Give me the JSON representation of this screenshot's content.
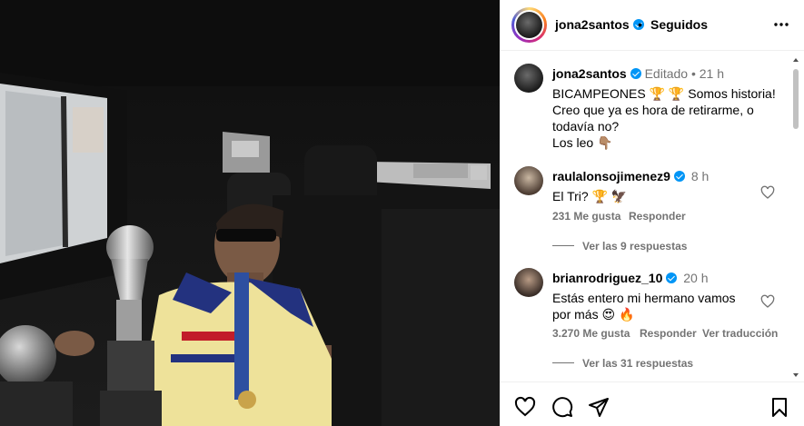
{
  "post": {
    "username": "jona2santos",
    "separator": "•",
    "follow_status": "Seguidos"
  },
  "caption": {
    "username": "jona2santos",
    "edited": "Editado",
    "dot": "•",
    "time": "21 h",
    "line1_text": "BICAMPEONES",
    "line1_emoji": "🏆 🏆",
    "line1_tail": "Somos historia!",
    "line2": "Creo que ya es hora de retirarme, o",
    "line3": "todavía no?",
    "line4_text": "Los leo",
    "line4_emoji": "👇🏽"
  },
  "comments": [
    {
      "username": "raulalonsojimenez9",
      "time": "8 h",
      "text": "El Tri?",
      "emoji": "🏆 🦅",
      "likes": "231 Me gusta",
      "reply": "Responder",
      "view_replies": "Ver las 9 respuestas"
    },
    {
      "username": "brianrodriguez_10",
      "time": "20 h",
      "text_line1": "Estás entero mi hermano vamos",
      "text_line2": "por más",
      "emoji": "😍 🔥",
      "likes": "3.270 Me gusta",
      "reply": "Responder",
      "translate": "Ver traducción",
      "view_replies": "Ver las 31 respuestas"
    }
  ],
  "icons": {
    "header_more": "more-horizontal-icon",
    "verified": "verified-badge-icon",
    "like": "heart-outline-icon",
    "comment": "comment-bubble-icon",
    "share": "paper-plane-icon",
    "save": "bookmark-icon"
  },
  "colors": {
    "verified_blue": "#0095f6",
    "secondary_text": "#737373",
    "divider": "#efefef",
    "jersey_yellow": "#eee29a",
    "jersey_blue": "#23327f"
  }
}
